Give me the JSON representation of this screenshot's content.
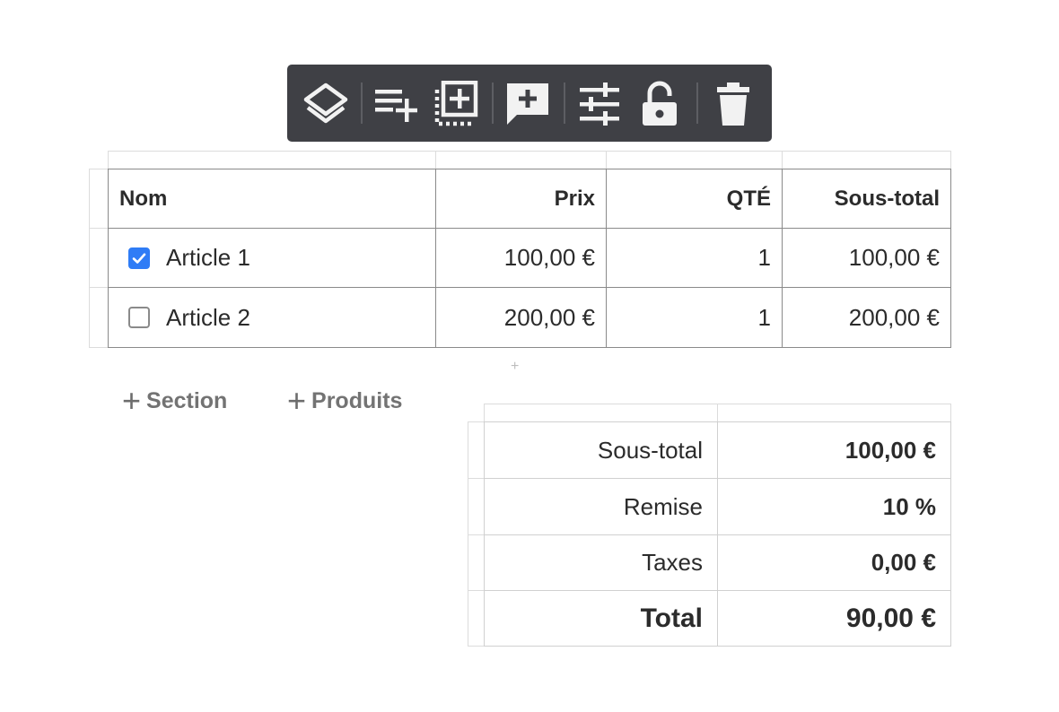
{
  "toolbar": {
    "buttons": [
      {
        "name": "layers-button",
        "icon": "layers-icon"
      },
      {
        "name": "add-row-button",
        "icon": "playlist-add-icon"
      },
      {
        "name": "add-block-button",
        "icon": "select-add-icon"
      },
      {
        "name": "add-comment-button",
        "icon": "comment-add-icon"
      },
      {
        "name": "settings-button",
        "icon": "tune-icon"
      },
      {
        "name": "lock-button",
        "icon": "lock-open-icon"
      },
      {
        "name": "delete-button",
        "icon": "trash-icon"
      }
    ],
    "colors": {
      "background": "#3f4045",
      "icon": "#f2f2f2"
    }
  },
  "items_table": {
    "headers": {
      "name": "Nom",
      "price": "Prix",
      "qty": "QTÉ",
      "subtotal": "Sous-total"
    },
    "rows": [
      {
        "checked": true,
        "name": "Article 1",
        "price": "100,00 €",
        "qty": "1",
        "subtotal": "100,00 €"
      },
      {
        "checked": false,
        "name": "Article 2",
        "price": "200,00 €",
        "qty": "1",
        "subtotal": "200,00 €"
      }
    ]
  },
  "actions": {
    "add_section": "Section",
    "add_products": "Produits",
    "plus_symbol": "+"
  },
  "totals": {
    "subtotal_label": "Sous-total",
    "subtotal_value": "100,00 €",
    "discount_label": "Remise",
    "discount_value": "10 %",
    "taxes_label": "Taxes",
    "taxes_value": "0,00 €",
    "total_label": "Total",
    "total_value": "90,00 €"
  },
  "colors": {
    "checkbox_accent": "#2f7cf6"
  }
}
